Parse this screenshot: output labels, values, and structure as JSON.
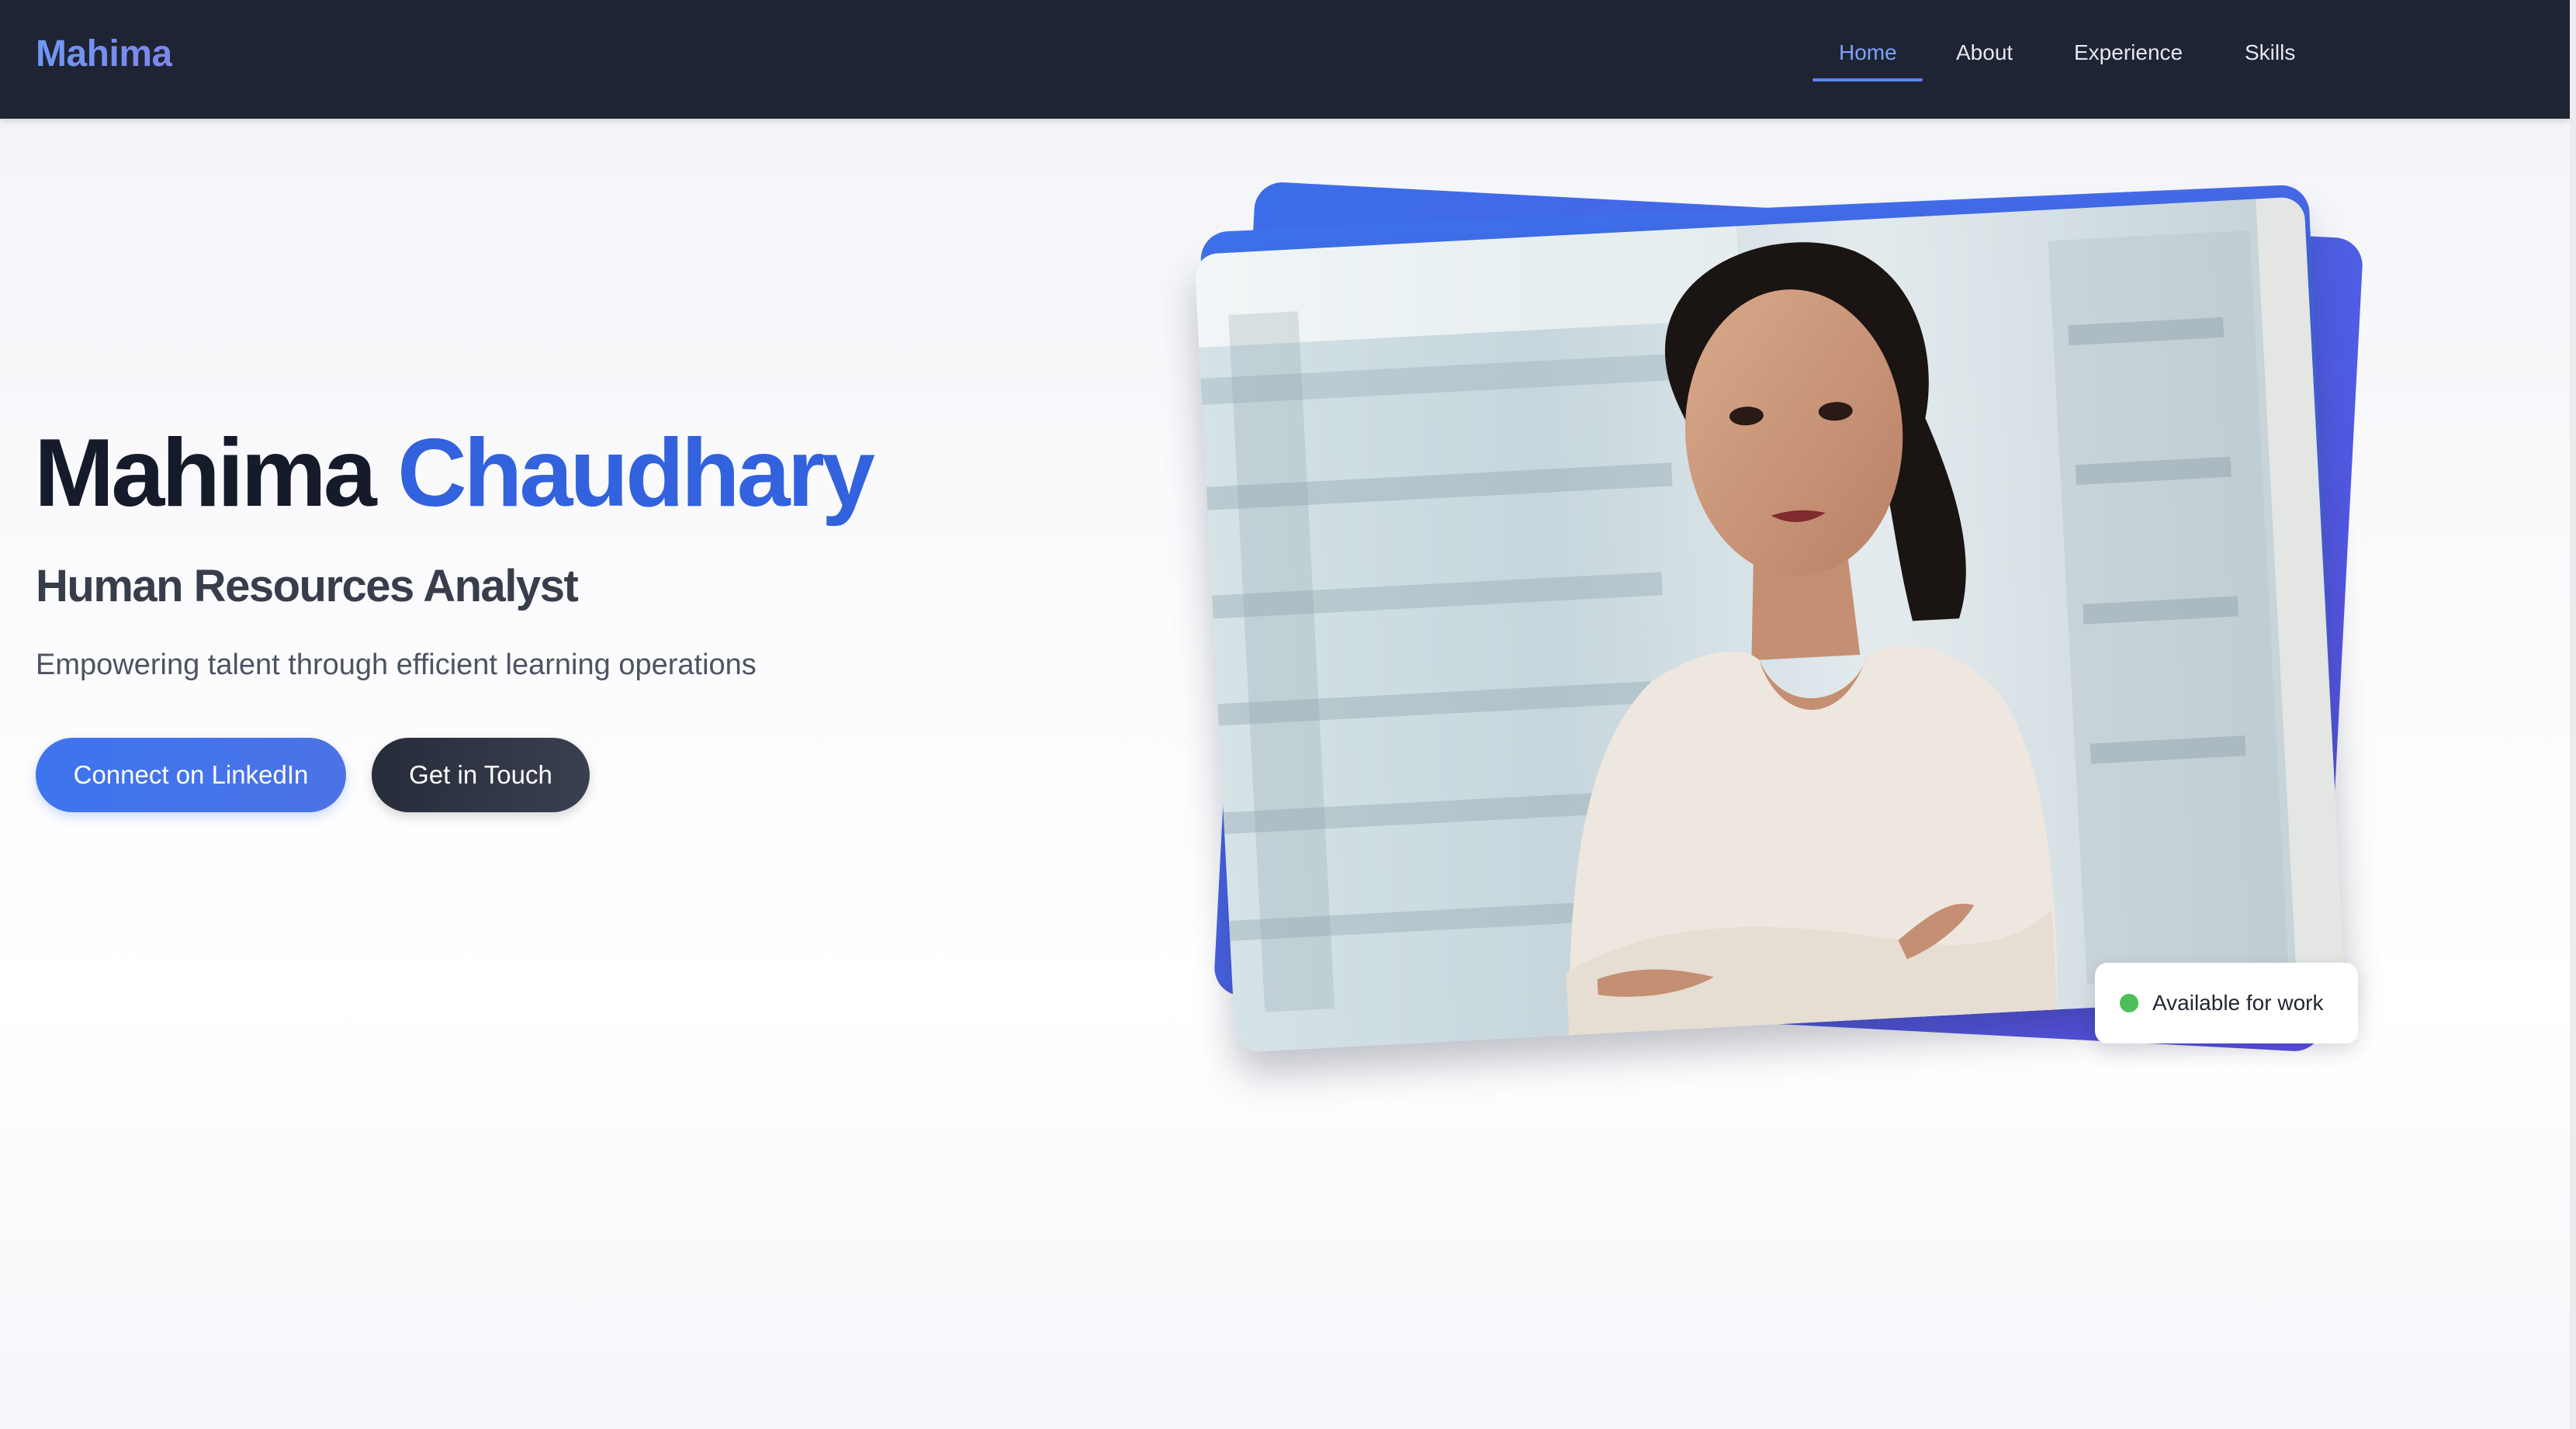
{
  "nav": {
    "brand": "Mahima",
    "links": [
      {
        "label": "Home",
        "active": true
      },
      {
        "label": "About",
        "active": false
      },
      {
        "label": "Experience",
        "active": false
      },
      {
        "label": "Skills",
        "active": false
      }
    ]
  },
  "hero": {
    "first_name": "Mahima",
    "last_name": "Chaudhary",
    "role": "Human Resources Analyst",
    "tagline": "Empowering talent through efficient learning operations",
    "primary_button": "Connect on LinkedIn",
    "secondary_button": "Get in Touch"
  },
  "portrait": {
    "badge_text": "Available for work",
    "badge_status_color": "#4cbf5a"
  },
  "colors": {
    "nav_bg": "#1e2433",
    "accent": "#3262dd",
    "brand_gradient": [
      "#6f98f5",
      "#7e86e8"
    ],
    "dark_button": "#2b3040"
  }
}
